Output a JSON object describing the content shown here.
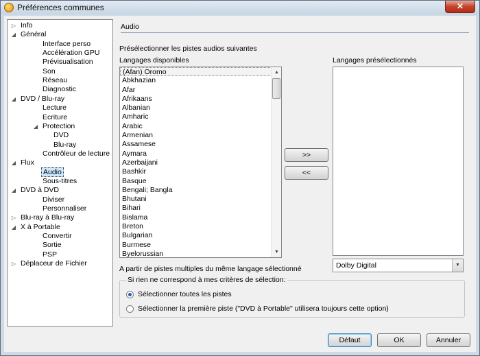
{
  "window": {
    "title": "Préférences communes",
    "close_glyph": "✕"
  },
  "tree": [
    {
      "label": "Info",
      "level": 0,
      "twisty": "▷"
    },
    {
      "label": "Général",
      "level": 0,
      "twisty": "◢"
    },
    {
      "label": "Interface perso",
      "level": 2
    },
    {
      "label": "Accélération GPU",
      "level": 2
    },
    {
      "label": "Prévisualisation",
      "level": 2
    },
    {
      "label": "Son",
      "level": 2
    },
    {
      "label": "Réseau",
      "level": 2
    },
    {
      "label": "Diagnostic",
      "level": 2
    },
    {
      "label": "DVD / Blu-ray",
      "level": 0,
      "twisty": "◢"
    },
    {
      "label": "Lecture",
      "level": 2
    },
    {
      "label": "Ecriture",
      "level": 2
    },
    {
      "label": "Protection",
      "level": 2,
      "twisty": "◢"
    },
    {
      "label": "DVD",
      "level": 3
    },
    {
      "label": "Blu-ray",
      "level": 3
    },
    {
      "label": "Contrôleur de lecture",
      "level": 2
    },
    {
      "label": "Flux",
      "level": 0,
      "twisty": "◢"
    },
    {
      "label": "Audio",
      "level": 2,
      "selected": true
    },
    {
      "label": "Sous-titres",
      "level": 2
    },
    {
      "label": "DVD à DVD",
      "level": 0,
      "twisty": "◢"
    },
    {
      "label": "Diviser",
      "level": 2
    },
    {
      "label": "Personnaliser",
      "level": 2
    },
    {
      "label": "Blu-ray à Blu-ray",
      "level": 0,
      "twisty": "▷"
    },
    {
      "label": "X à Portable",
      "level": 0,
      "twisty": "◢"
    },
    {
      "label": "Convertir",
      "level": 2
    },
    {
      "label": "Sortie",
      "level": 2
    },
    {
      "label": "PSP",
      "level": 2
    },
    {
      "label": "Déplaceur de Fichier",
      "level": 0,
      "twisty": "▷"
    }
  ],
  "panel": {
    "section_title": "Audio",
    "preselect_label": "Présélectionner les pistes audios suivantes",
    "available_label": "Langages disponibles",
    "preselected_label": "Langages présélectionnés",
    "available_languages": [
      "(Afan) Oromo",
      "Abkhazian",
      "Afar",
      "Afrikaans",
      "Albanian",
      "Amharic",
      "Arabic",
      "Armenian",
      "Assamese",
      "Aymara",
      "Azerbaijani",
      "Bashkir",
      "Basque",
      "Bengali; Bangla",
      "Bhutani",
      "Bihari",
      "Bislama",
      "Breton",
      "Bulgarian",
      "Burmese",
      "Byelorussian"
    ],
    "add_button": ">>",
    "remove_button": "<<",
    "multi_track_label": "A partir de pistes multiples du même langage sélectionné",
    "format_select": {
      "value": "Dolby Digital"
    },
    "fallback_group": {
      "legend": "Si rien ne correspond à mes critères de sélection:",
      "options": [
        {
          "label": "Sélectionner toutes les pistes",
          "checked": true
        },
        {
          "label": "Sélectionner la première piste (\"DVD à Portable\" utilisera toujours cette option)",
          "checked": false
        }
      ]
    }
  },
  "footer": {
    "default_label": "Défaut",
    "ok_label": "OK",
    "cancel_label": "Annuler"
  },
  "icons": {
    "scroll_up": "▲",
    "scroll_down": "▼",
    "dropdown": "▼"
  }
}
